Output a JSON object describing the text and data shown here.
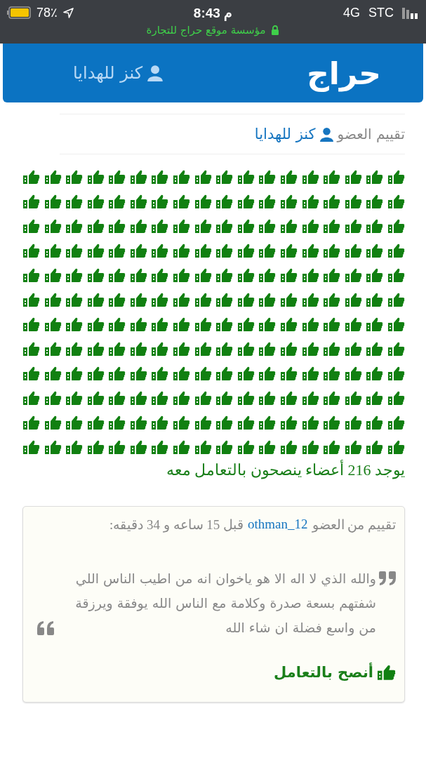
{
  "status_bar": {
    "battery": "78٪",
    "time": "8:43 م",
    "network": "4G",
    "carrier": "STC",
    "site": "مؤسسة موقع حراج للتجارة"
  },
  "header": {
    "logo": "حراج",
    "user": "كنز للهدايا"
  },
  "member": {
    "label": "تقييم العضو",
    "name": "كنز للهدايا"
  },
  "summary": "يوجد 216 أعضاء ينصحون بالتعامل معه",
  "review": {
    "prefix": "تقييم من العضو",
    "author": "othman_12",
    "time": "قبل 15 ساعه و 34 دقيقه:",
    "text": "والله الذي لا اله الا هو ياخوان انه من اطيب الناس اللي شفتهم بسعة صدرة وكلامة مع الناس الله يوفقة ويرزقة من واسع فضلة ان شاء الله",
    "verdict": "أنصح بالتعامل"
  }
}
